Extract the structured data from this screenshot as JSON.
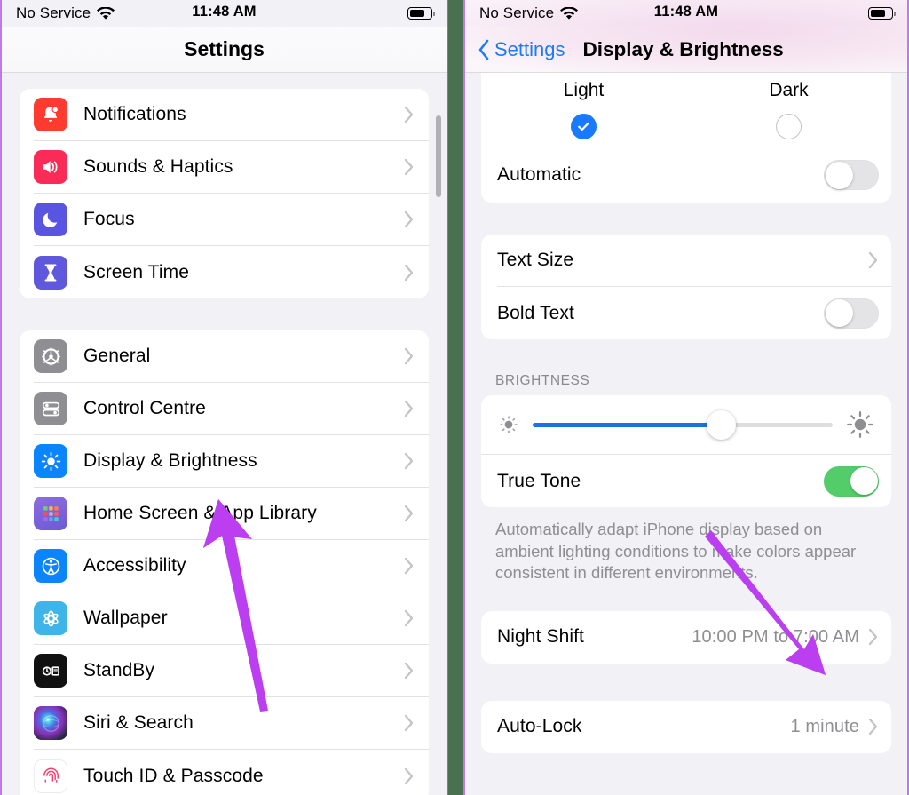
{
  "left_phone": {
    "status_bar": {
      "carrier": "No Service",
      "time": "11:48 AM",
      "wifi_icon": "wifi-icon",
      "battery_icon": "battery-icon"
    },
    "nav_title": "Settings",
    "groups": [
      {
        "items": [
          {
            "label": "Notifications",
            "icon": "notifications-icon",
            "icon_color": "#ff3b30"
          },
          {
            "label": "Sounds & Haptics",
            "icon": "sounds-icon",
            "icon_color": "#fa2b56"
          },
          {
            "label": "Focus",
            "icon": "focus-moon-icon",
            "icon_color": "#5a55e0"
          },
          {
            "label": "Screen Time",
            "icon": "hourglass-icon",
            "icon_color": "#5f58dd"
          }
        ]
      },
      {
        "items": [
          {
            "label": "General",
            "icon": "gear-icon",
            "icon_color": "#8e8e93"
          },
          {
            "label": "Control Centre",
            "icon": "sliders-icon",
            "icon_color": "#8e8e93"
          },
          {
            "label": "Display & Brightness",
            "icon": "brightness-icon",
            "icon_color": "#0a84ff"
          },
          {
            "label": "Home Screen & App Library",
            "icon": "app-grid-icon",
            "icon_color": "#6e5bd8"
          },
          {
            "label": "Accessibility",
            "icon": "accessibility-icon",
            "icon_color": "#0a84ff"
          },
          {
            "label": "Wallpaper",
            "icon": "wallpaper-icon",
            "icon_color": "#3fb4e8"
          },
          {
            "label": "StandBy",
            "icon": "standby-icon",
            "icon_color": "#111111"
          },
          {
            "label": "Siri & Search",
            "icon": "siri-icon",
            "icon_color": "#2d2d3a"
          },
          {
            "label": "Touch ID & Passcode",
            "icon": "fingerprint-icon",
            "icon_color": "#ffffff"
          }
        ]
      }
    ]
  },
  "right_phone": {
    "status_bar": {
      "carrier": "No Service",
      "time": "11:48 AM",
      "wifi_icon": "wifi-icon",
      "battery_icon": "battery-icon"
    },
    "back_label": "Settings",
    "nav_title": "Display & Brightness",
    "appearance": {
      "light_label": "Light",
      "dark_label": "Dark",
      "light_selected": true,
      "dark_selected": false,
      "automatic_label": "Automatic",
      "automatic_on": false
    },
    "text_group": {
      "text_size_label": "Text Size",
      "bold_text_label": "Bold Text",
      "bold_text_on": false
    },
    "brightness": {
      "section_header": "BRIGHTNESS",
      "slider_value_pct": 63,
      "low_icon": "brightness-low-icon",
      "high_icon": "brightness-high-icon",
      "true_tone_label": "True Tone",
      "true_tone_on": true,
      "footnote": "Automatically adapt iPhone display based on ambient lighting conditions to make colors appear consistent in different environments."
    },
    "night_shift": {
      "label": "Night Shift",
      "value": "10:00 PM to 7:00 AM"
    },
    "auto_lock": {
      "label": "Auto-Lock",
      "value": "1 minute"
    }
  },
  "annotations": {
    "arrow_color": "#bb3ef0",
    "arrows": [
      {
        "name": "arrow-to-display-brightness"
      },
      {
        "name": "arrow-to-night-shift"
      }
    ]
  },
  "colors": {
    "accent_blue": "#1a7aff",
    "toggle_green": "#53cd69",
    "divider_green": "#4a7052",
    "frame_purple": "#a855f7"
  }
}
